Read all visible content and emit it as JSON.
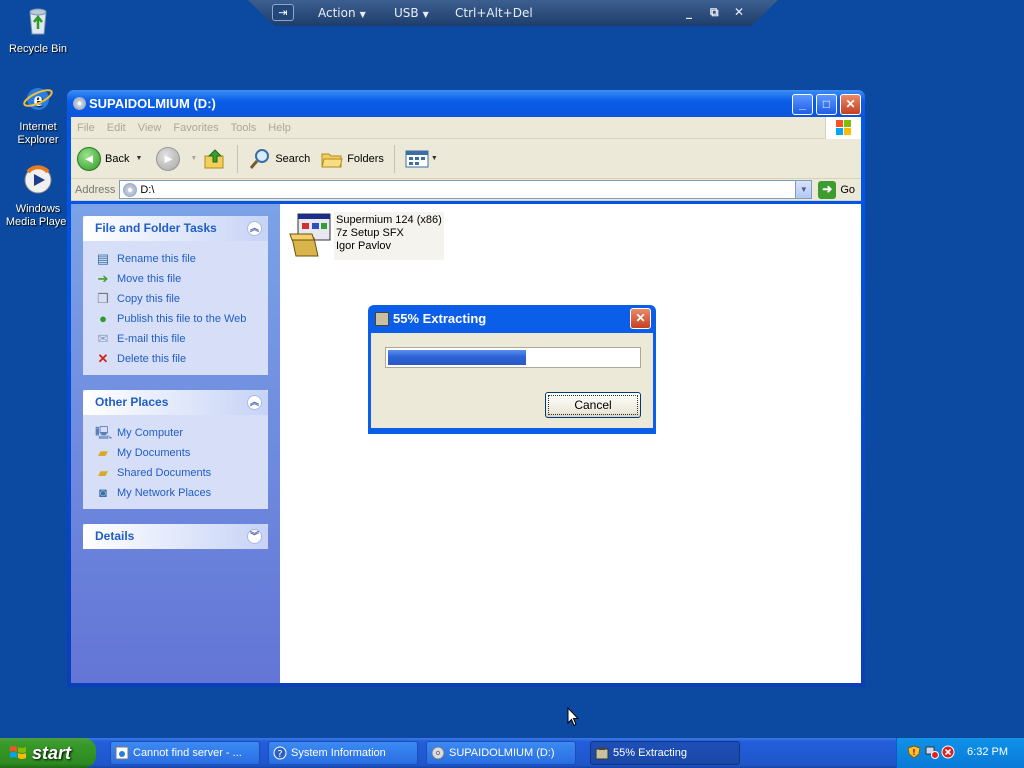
{
  "vm_toolbar": {
    "pin_label": "⇥",
    "action_label": "Action",
    "usb_label": "USB",
    "cad_label": "Ctrl+Alt+Del",
    "minimize": "_",
    "restore": "⧉",
    "close": "✕"
  },
  "desktop_icons": [
    {
      "label": "Recycle Bin",
      "icon": "recycle-bin-icon"
    },
    {
      "label": "Internet Explorer",
      "icon": "internet-explorer-icon"
    },
    {
      "label": "Windows Media Player",
      "icon": "media-player-icon"
    }
  ],
  "window": {
    "title": "SUPAIDOLMIUM (D:)",
    "menus": [
      "File",
      "Edit",
      "View",
      "Favorites",
      "Tools",
      "Help"
    ],
    "toolbar": {
      "back_label": "Back",
      "search_label": "Search",
      "folders_label": "Folders"
    },
    "address": {
      "label": "Address",
      "value": "D:\\",
      "go_label": "Go"
    },
    "panels": {
      "file_tasks": {
        "title": "File and Folder Tasks",
        "items": [
          "Rename this file",
          "Move this file",
          "Copy this file",
          "Publish this file to the Web",
          "E-mail this file",
          "Delete this file"
        ]
      },
      "other_places": {
        "title": "Other Places",
        "items": [
          "My Computer",
          "My Documents",
          "Shared Documents",
          "My Network Places"
        ]
      },
      "details": {
        "title": "Details"
      }
    },
    "file": {
      "name": "Supermium 124 (x86)",
      "type": "7z Setup SFX",
      "author": "Igor Pavlov"
    }
  },
  "dialog": {
    "title": "55% Extracting",
    "progress": 0.55,
    "cancel_label": "Cancel"
  },
  "taskbar": {
    "start_label": "start",
    "buttons": [
      {
        "label": "Cannot find server - ...",
        "active": false
      },
      {
        "label": "System Information",
        "active": false
      },
      {
        "label": "SUPAIDOLMIUM (D:)",
        "active": false
      },
      {
        "label": "55% Extracting",
        "active": true
      }
    ],
    "clock": "6:32 PM"
  },
  "colors": {
    "desktop": "#0b4aa0",
    "xp_blue": "#0a5ee8",
    "task_link": "#215dc6",
    "start_green": "#389a2a"
  }
}
